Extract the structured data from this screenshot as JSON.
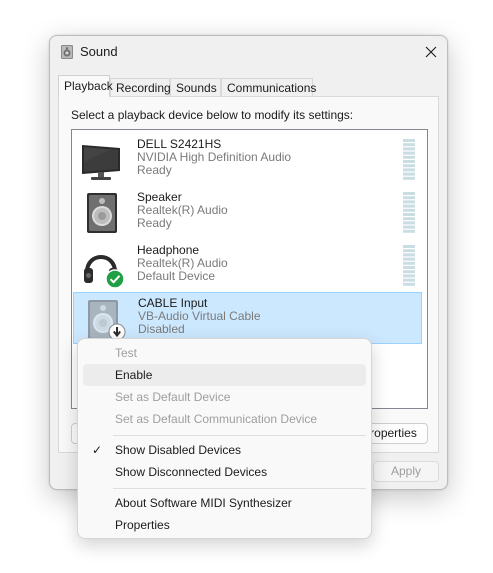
{
  "window": {
    "title": "Sound",
    "icon": "speaker-icon"
  },
  "tabs": [
    {
      "label": "Playback",
      "active": true
    },
    {
      "label": "Recording",
      "active": false
    },
    {
      "label": "Sounds",
      "active": false
    },
    {
      "label": "Communications",
      "active": false
    }
  ],
  "instruction": "Select a playback device below to modify its settings:",
  "devices": [
    {
      "name": "DELL S2421HS",
      "driver": "NVIDIA High Definition Audio",
      "status": "Ready",
      "icon": "monitor-icon"
    },
    {
      "name": "Speaker",
      "driver": "Realtek(R) Audio",
      "status": "Ready",
      "icon": "speaker-box-icon"
    },
    {
      "name": "Headphone",
      "driver": "Realtek(R) Audio",
      "status": "Default Device",
      "icon": "headphone-icon",
      "badge": "green-check-icon"
    },
    {
      "name": "CABLE Input",
      "driver": "VB-Audio Virtual Cable",
      "status": "Disabled",
      "icon": "speaker-box-icon",
      "badge": "disabled-arrow-icon",
      "selected": true
    }
  ],
  "buttons": {
    "properties_partial": "roperties",
    "apply": "Apply"
  },
  "context_menu": {
    "items": [
      {
        "label": "Test",
        "enabled": false
      },
      {
        "label": "Enable",
        "enabled": true,
        "hovered": true
      },
      {
        "label": "Set as Default Device",
        "enabled": false
      },
      {
        "label": "Set as Default Communication Device",
        "enabled": false
      },
      {
        "label": "Show Disabled Devices",
        "enabled": true,
        "checked": true
      },
      {
        "label": "Show Disconnected Devices",
        "enabled": true
      },
      {
        "label": "About Software MIDI Synthesizer",
        "enabled": true
      },
      {
        "label": "Properties",
        "enabled": true
      }
    ],
    "check_glyph": "✓"
  },
  "colors": {
    "selection_bg": "#cce8ff",
    "selection_border": "#99d1ff",
    "check_green": "#1fa045"
  }
}
